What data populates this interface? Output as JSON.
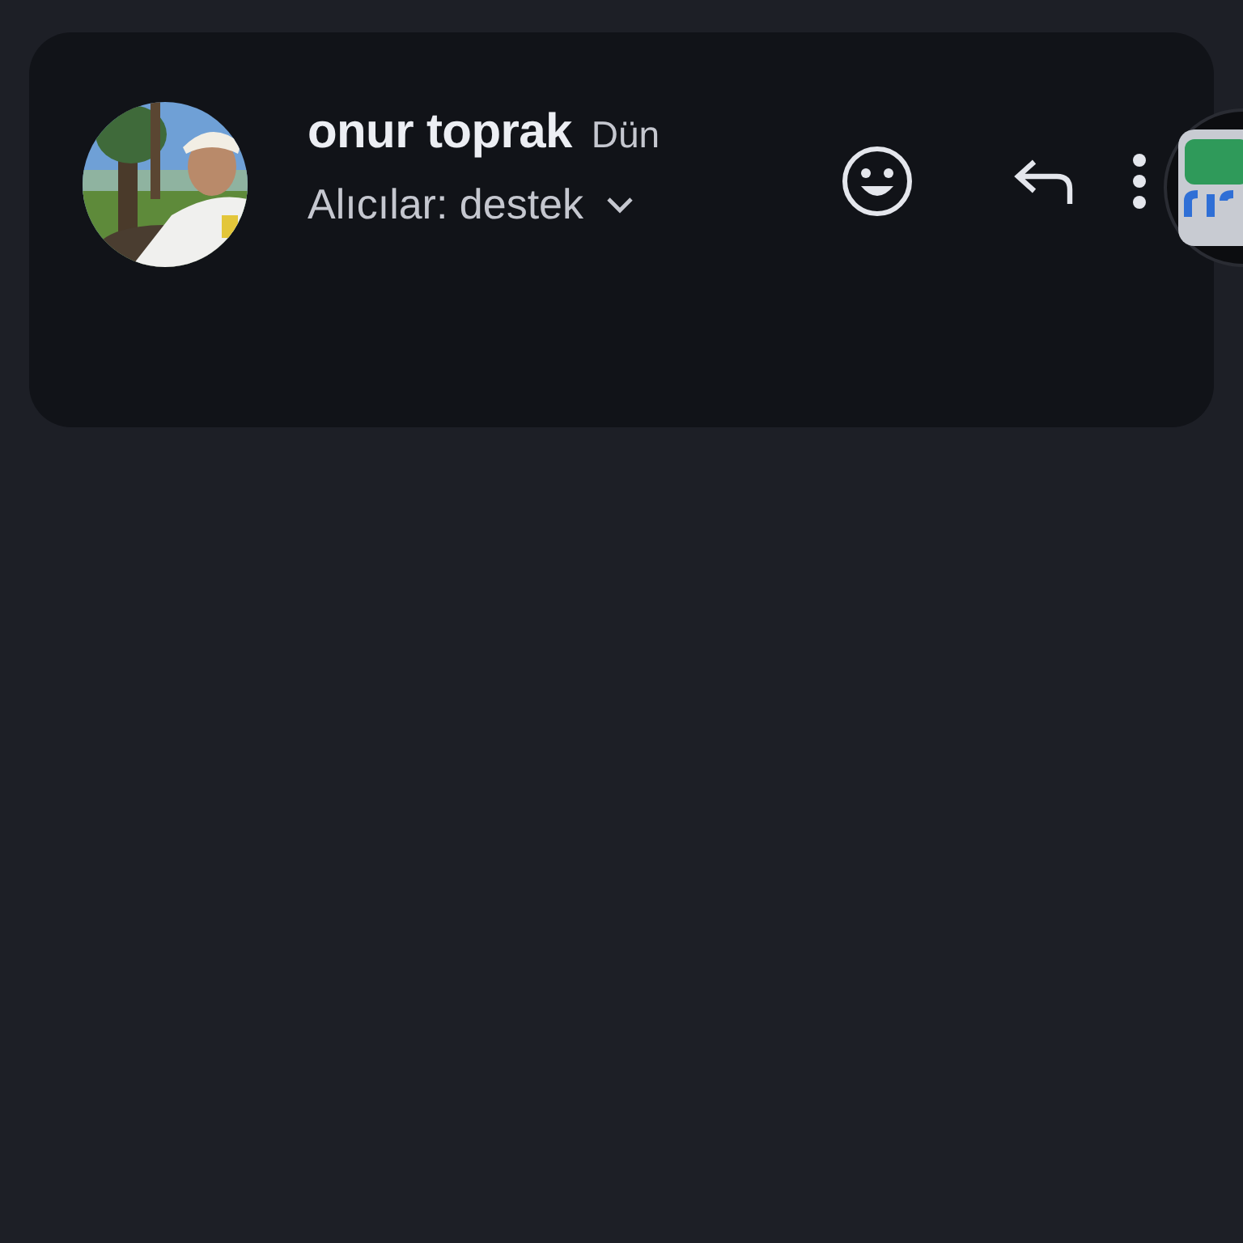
{
  "message_header": {
    "sender": "onur toprak",
    "time": "Dün",
    "recipients": "Alıcılar: destek"
  }
}
